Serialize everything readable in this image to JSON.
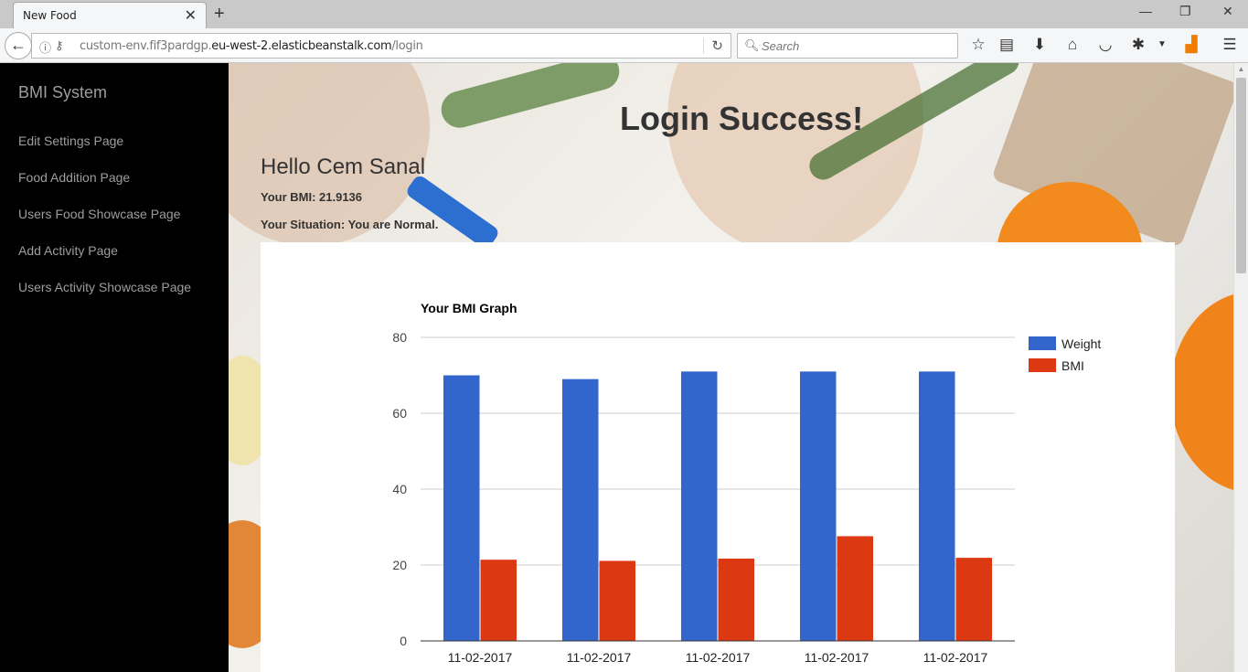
{
  "browser": {
    "tab_title": "New Food",
    "url_prefix": "custom-env.fif3pardgp.",
    "url_domain": "eu-west-2.elasticbeanstalk.com",
    "url_path": "/login",
    "search_placeholder": "Search"
  },
  "sidebar": {
    "brand": "BMI System",
    "links": [
      "Edit Settings Page",
      "Food Addition Page",
      "Users Food Showcase Page",
      "Add Activity Page",
      "Users Activity Showcase Page"
    ]
  },
  "main": {
    "heading": "Login Success!",
    "greeting": "Hello Cem Sanal",
    "bmi_line": "Your BMI: 21.9136",
    "situation_line": "Your Situation: You are Normal."
  },
  "colors": {
    "weight": "#3366cc",
    "bmi": "#dc3912",
    "sidebar_bg": "#000000",
    "gridline": "#cccccc"
  },
  "chart_data": {
    "type": "bar",
    "title": "Your BMI Graph",
    "categories": [
      "11-02-2017",
      "11-02-2017",
      "11-02-2017",
      "11-02-2017",
      "11-02-2017"
    ],
    "series": [
      {
        "name": "Weight",
        "values": [
          70,
          69,
          71,
          71,
          71
        ]
      },
      {
        "name": "BMI",
        "values": [
          21.4,
          21.1,
          21.7,
          27.6,
          21.9
        ]
      }
    ],
    "ylim": [
      0,
      80
    ],
    "yticks": [
      0,
      20,
      40,
      60,
      80
    ],
    "grid": true,
    "legend": "right"
  }
}
